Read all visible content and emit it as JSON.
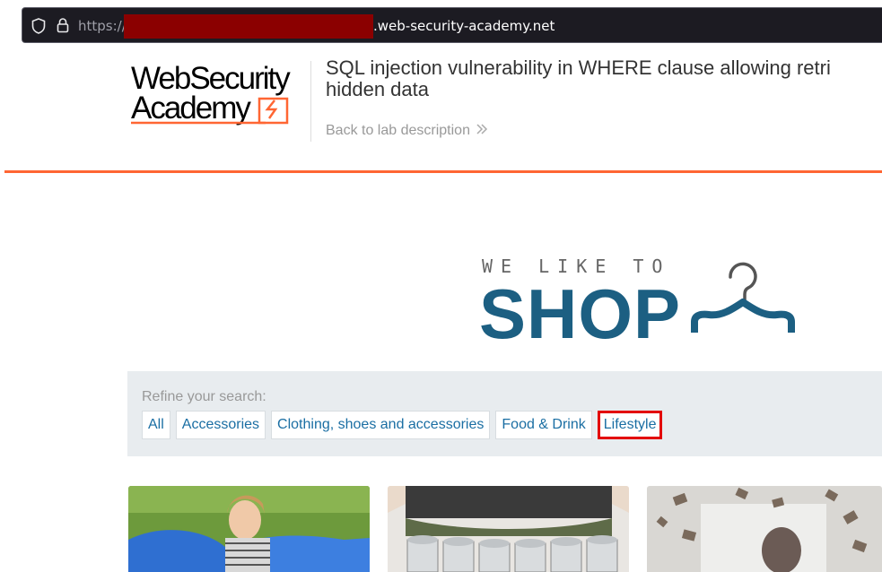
{
  "browser": {
    "url_scheme": "https://",
    "url_domain": ".web-security-academy.net",
    "icons": [
      "shield-icon",
      "lock-icon"
    ]
  },
  "academy_header": {
    "logo_line1": "WebSecurity",
    "logo_line2": "Academy",
    "lab_title_line1": "SQL injection vulnerability in WHERE clause allowing retri",
    "lab_title_line2": "hidden data",
    "back_link": "Back to lab description"
  },
  "banner": {
    "tagline": "WE LIKE TO",
    "word": "SHOP",
    "color": "#1c5f82"
  },
  "filters": {
    "label": "Refine your search:",
    "items": [
      {
        "label": "All"
      },
      {
        "label": "Accessories"
      },
      {
        "label": "Clothing, shoes and accessories"
      },
      {
        "label": "Food & Drink"
      },
      {
        "label": "Lifestyle",
        "highlighted": true
      }
    ]
  },
  "colors": {
    "accent_orange": "#ff6633",
    "link_blue": "#1a6ea3",
    "highlight_red": "#e30000"
  }
}
